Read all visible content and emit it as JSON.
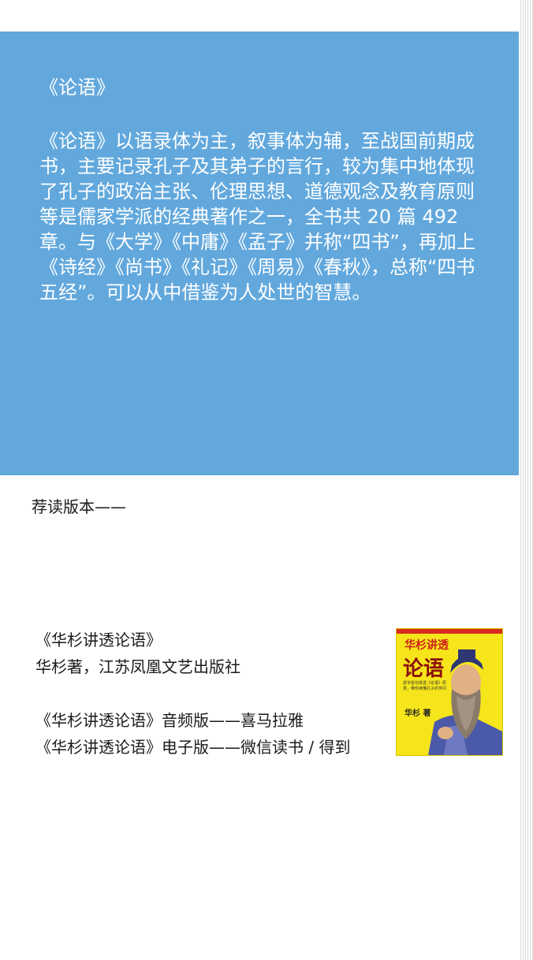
{
  "intro": {
    "title": "《论语》",
    "body": "《论语》以语录体为主，叙事体为辅，至战国前期成书，主要记录孔子及其弟子的言行，较为集中地体现了孔子的政治主张、伦理思想、道德观念及教育原则等是儒家学派的经典著作之一，全书共 20 篇 492 章。与《大学》《中庸》《孟子》并称“四书”，再加上《诗经》《尚书》《礼记》《周易》《春秋》，总称“四书五经”。可以从中借鉴为人处世的智慧。"
  },
  "recommend": {
    "heading": "荐读版本——",
    "book_title": "《华杉讲透论语》",
    "book_author": "华杉著，江苏凤凰文艺出版社",
    "audio_version": "《华杉讲透论语》音频版——喜马拉雅",
    "ebook_version": "《华杉讲透论语》电子版——微信读书 / 得到"
  },
  "cover": {
    "series": "华杉讲透",
    "title": "论语",
    "tagline": "逐字逐句讲透《论语》原意，带你读懂孔子的学问",
    "author": "华杉 著",
    "background": "#f6e51a",
    "title_color": "#8b0f0f"
  },
  "colors": {
    "card_bg": "#62a8dd",
    "text_dark": "#1a1a1a"
  }
}
